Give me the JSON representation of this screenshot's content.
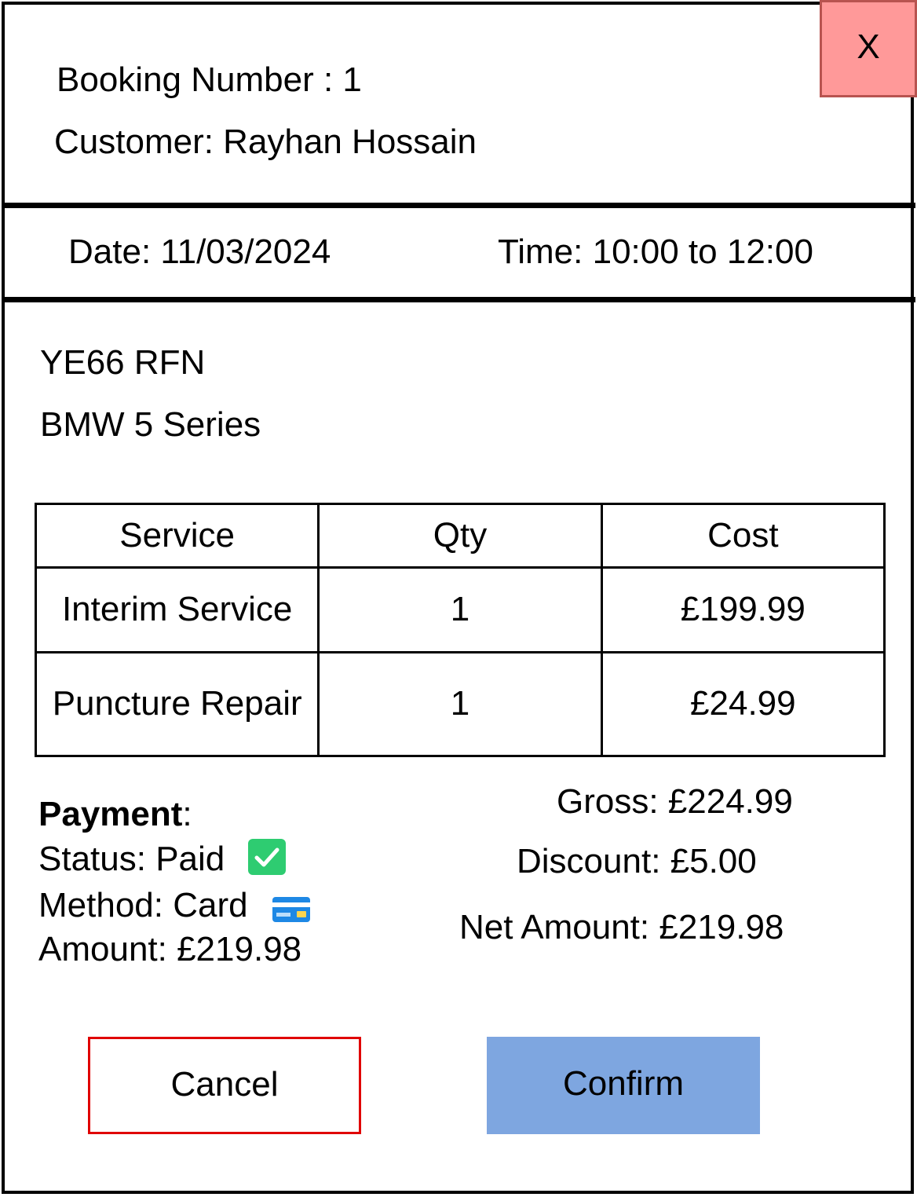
{
  "header": {
    "booking_label": "Booking Number : 1",
    "customer_label": "Customer: Rayhan Hossain",
    "close_label": "X"
  },
  "schedule": {
    "date_label": "Date: 11/03/2024",
    "time_label": "Time: 10:00 to 12:00"
  },
  "vehicle": {
    "registration": "YE66 RFN",
    "model": "BMW 5 Series"
  },
  "services": {
    "columns": [
      "Service",
      "Qty",
      "Cost"
    ],
    "rows": [
      {
        "service": "Interim Service",
        "qty": "1",
        "cost": "£199.99"
      },
      {
        "service": "Puncture Repair",
        "qty": "1",
        "cost": "£24.99"
      }
    ]
  },
  "payment": {
    "heading": "Payment",
    "heading_suffix": ":",
    "status_label": "Status: Paid",
    "status_icon": "check-icon",
    "method_label": "Method: Card",
    "method_icon": "credit-card-icon",
    "amount_label": "Amount: £219.98"
  },
  "totals": {
    "gross_label": "Gross: £224.99",
    "discount_label": "Discount: £5.00",
    "net_label": "Net Amount: £219.98"
  },
  "actions": {
    "cancel_label": "Cancel",
    "confirm_label": "Confirm"
  },
  "colors": {
    "close_bg": "#ff9999",
    "close_border": "#b85450",
    "cancel_border": "#e00000",
    "confirm_bg": "#7ea6e0",
    "status_icon": "#2ecc71"
  }
}
